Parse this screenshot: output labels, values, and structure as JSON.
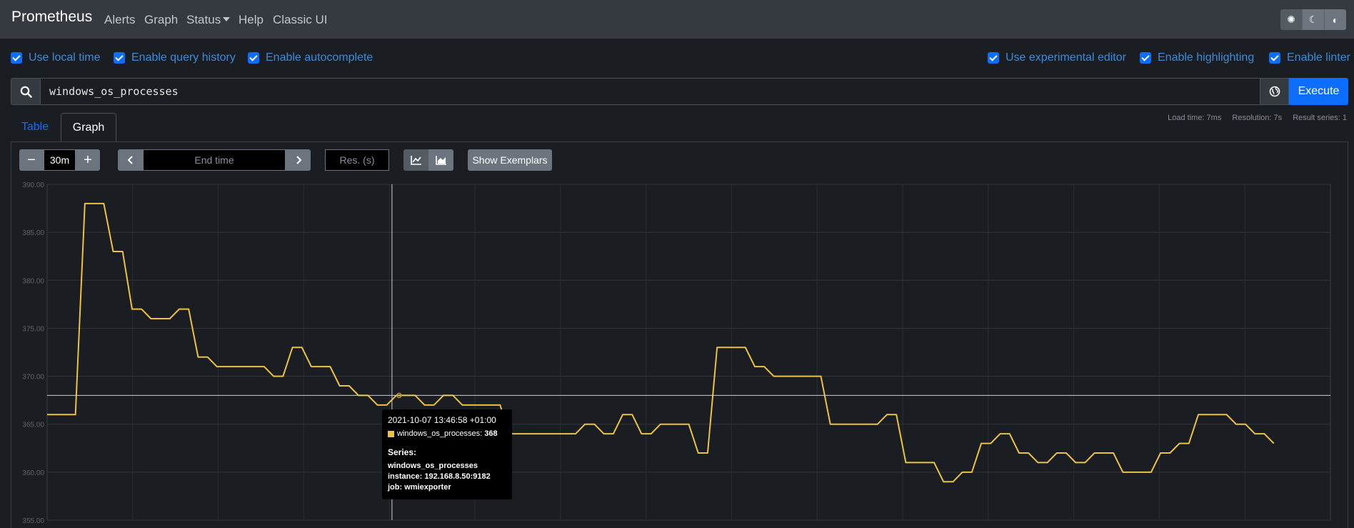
{
  "nav": {
    "brand": "Prometheus",
    "items": [
      "Alerts",
      "Graph",
      "Status",
      "Help",
      "Classic UI"
    ]
  },
  "theme_icons": [
    "sun-icon",
    "moon-icon",
    "adjust-icon"
  ],
  "options_left": [
    "Use local time",
    "Enable query history",
    "Enable autocomplete"
  ],
  "options_right": [
    "Use experimental editor",
    "Enable highlighting",
    "Enable linter"
  ],
  "query": {
    "value": "windows_os_processes",
    "execute_label": "Execute"
  },
  "tabs": [
    "Table",
    "Graph"
  ],
  "stats": {
    "load_time": "Load time: 7ms",
    "resolution": "Resolution: 7s",
    "result_series": "Result series: 1"
  },
  "controls": {
    "range": "30m",
    "end_time_placeholder": "End time",
    "res_placeholder": "Res. (s)",
    "exemplars_label": "Show Exemplars"
  },
  "chart_data": {
    "type": "line",
    "ylim": [
      355,
      390
    ],
    "yticks": [
      390,
      385,
      380,
      375,
      370,
      365,
      360,
      355
    ],
    "ytick_labels": [
      "390.00",
      "385.00",
      "380.00",
      "375.00",
      "370.00",
      "365.00",
      "360.00",
      "355.00"
    ],
    "grid": true,
    "color": "#edc240",
    "x_index_range": [
      0,
      136
    ],
    "series": [
      {
        "values": [
          366,
          366,
          366,
          366,
          388,
          388,
          388,
          383,
          383,
          377,
          377,
          376,
          376,
          376,
          377,
          377,
          372,
          372,
          371,
          371,
          371,
          371,
          371,
          371,
          370,
          370,
          373,
          373,
          371,
          371,
          371,
          369,
          369,
          368,
          368,
          367,
          367,
          368,
          368,
          368,
          367,
          367,
          368,
          368,
          367,
          367,
          367,
          367,
          367,
          364,
          364,
          364,
          364,
          364,
          364,
          364,
          364,
          365,
          365,
          364,
          364,
          366,
          366,
          364,
          364,
          365,
          365,
          365,
          365,
          362,
          362,
          373,
          373,
          373,
          373,
          371,
          371,
          370,
          370,
          370,
          370,
          370,
          370,
          365,
          365,
          365,
          365,
          365,
          365,
          366,
          366,
          361,
          361,
          361,
          361,
          359,
          359,
          360,
          360,
          363,
          363,
          364,
          364,
          362,
          362,
          361,
          361,
          362,
          362,
          361,
          361,
          362,
          362,
          362,
          360,
          360,
          360,
          360,
          362,
          362,
          363,
          363,
          366,
          366,
          366,
          366,
          365,
          365,
          364,
          364,
          363
        ]
      }
    ],
    "hover": {
      "crosshair_value": 368,
      "point_index": 37
    }
  },
  "tooltip": {
    "time": "2021-10-07 13:46:58 +01:00",
    "series_line_name": "windows_os_processes:",
    "series_line_value": "368",
    "series_heading": "Series:",
    "metric": "windows_os_processes",
    "instance": "instance: 192.168.8.50:9182",
    "job": "job: wmiexporter"
  }
}
